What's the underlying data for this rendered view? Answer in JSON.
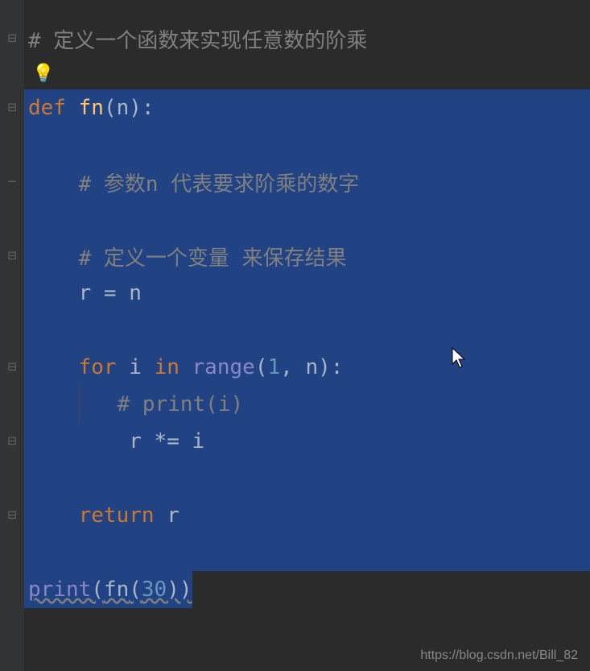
{
  "code": {
    "comment_top": "# 定义一个函数来实现任意数的阶乘",
    "def_kw": "def",
    "fn_name": "fn",
    "param": "n",
    "comment_param": "# 参数n 代表要求阶乘的数字",
    "comment_var": "# 定义一个变量 来保存结果",
    "assign_r": "r = n",
    "for_kw": "for",
    "loop_var": "i",
    "in_kw": "in",
    "range_fn": "range",
    "range_args_1": "1",
    "range_args_n": "n",
    "comment_print": "# print(i)",
    "mult_assign": "r *= i",
    "return_kw": "return",
    "return_val": "r",
    "print_fn": "print",
    "call_fn": "fn",
    "call_arg": "30"
  },
  "watermark": "https://blog.csdn.net/Bill_82"
}
